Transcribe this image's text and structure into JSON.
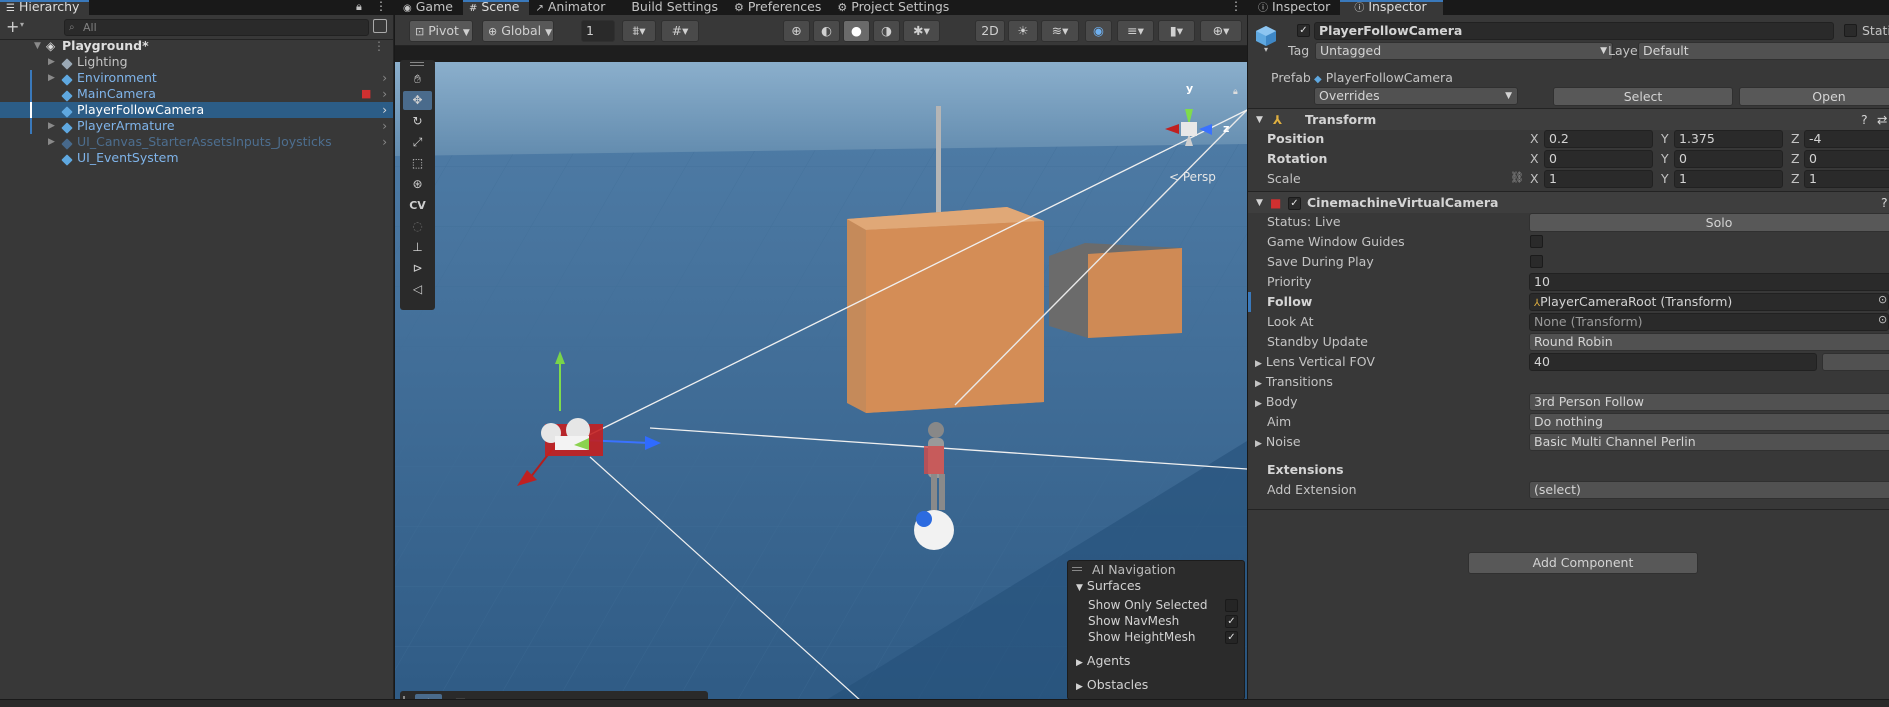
{
  "hierarchy": {
    "tab": "Hierarchy",
    "search_placeholder": "All",
    "scene": "Playground*",
    "items": [
      {
        "label": "Lighting",
        "color": "#c4c4c4"
      },
      {
        "label": "Environment",
        "color": "#7fb4ea"
      },
      {
        "label": "MainCamera",
        "color": "#7fb4ea"
      },
      {
        "label": "PlayerFollowCamera",
        "color": "#ffffff"
      },
      {
        "label": "PlayerArmature",
        "color": "#7fb4ea"
      },
      {
        "label": "UI_Canvas_StarterAssetsInputs_Joysticks",
        "color": "#4d6e8f"
      },
      {
        "label": "UI_EventSystem",
        "color": "#7fb4ea"
      }
    ]
  },
  "center_tabs": [
    "Game",
    "Scene",
    "Animator",
    "Build Settings",
    "Preferences",
    "Project Settings"
  ],
  "scene_toolbar": {
    "pivot": "Pivot",
    "global": "Global",
    "grid_value": "1",
    "cv": "CV",
    "persp": "< Persp"
  },
  "gizmo_axes": {
    "y": "y",
    "z": "z"
  },
  "ai_navigation": {
    "title": "AI Navigation",
    "surfaces": "Surfaces",
    "options": [
      {
        "label": "Show Only Selected",
        "checked": false
      },
      {
        "label": "Show NavMesh",
        "checked": true
      },
      {
        "label": "Show HeightMesh",
        "checked": true
      }
    ],
    "agents": "Agents",
    "obstacles": "Obstacles"
  },
  "inspector": {
    "tabs": [
      "Inspector",
      "Inspector"
    ],
    "object_name": "PlayerFollowCamera",
    "static_label": "Static",
    "tag_label": "Tag",
    "tag_value": "Untagged",
    "layer_label": "Layer",
    "layer_value": "Default",
    "prefab_label": "Prefab",
    "prefab_value": "PlayerFollowCamera",
    "overrides": "Overrides",
    "select": "Select",
    "open": "Open",
    "transform": {
      "title": "Transform",
      "position_label": "Position",
      "position": [
        "0.2",
        "1.375",
        "-4"
      ],
      "rotation_label": "Rotation",
      "rotation": [
        "0",
        "0",
        "0"
      ],
      "scale_label": "Scale",
      "scale": [
        "1",
        "1",
        "1"
      ],
      "axes": [
        "X",
        "Y",
        "Z"
      ]
    },
    "cinemachine": {
      "title": "CinemachineVirtualCamera",
      "status": "Status: Live",
      "solo": "Solo",
      "game_window_guides": "Game Window Guides",
      "save_during_play": "Save During Play",
      "priority_label": "Priority",
      "priority": "10",
      "follow_label": "Follow",
      "follow": "PlayerCameraRoot (Transform)",
      "look_at_label": "Look At",
      "look_at": "None (Transform)",
      "standby_label": "Standby Update",
      "standby": "Round Robin",
      "fov_label": "Lens Vertical FOV",
      "fov": "40",
      "transitions": "Transitions",
      "body_label": "Body",
      "body": "3rd Person Follow",
      "aim_label": "Aim",
      "aim": "Do nothing",
      "noise_label": "Noise",
      "noise": "Basic Multi Channel Perlin",
      "extensions": "Extensions",
      "add_extension_label": "Add Extension",
      "add_extension": "(select)"
    },
    "add_component": "Add Component"
  }
}
